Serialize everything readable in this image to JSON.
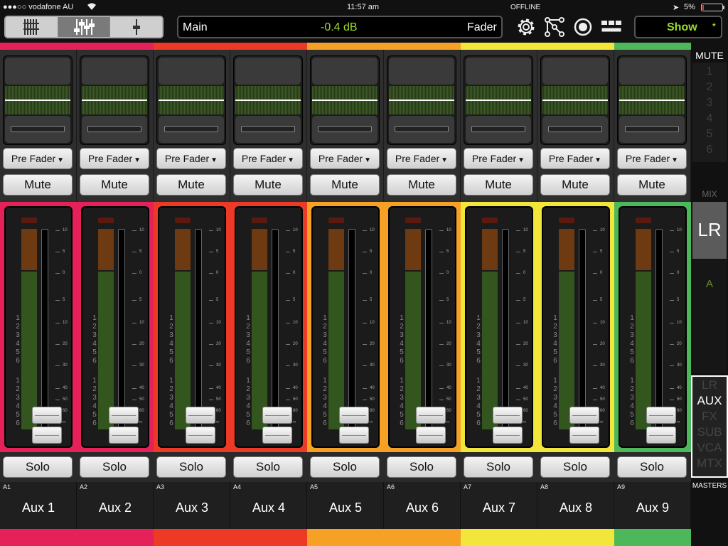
{
  "status": {
    "carrier": "●●●○○ vodafone AU",
    "wifi": "wifi-icon",
    "time": "11:57 am",
    "offline": "OFFLINE",
    "battery": "5%"
  },
  "toolbar": {
    "views": [
      "fader-bank-view",
      "mix-view",
      "single-channel-view"
    ],
    "channel_name": "Main",
    "channel_value": "-0.4 dB",
    "channel_mode": "Fader",
    "show_label": "Show",
    "show_star": "*"
  },
  "strips": [
    {
      "id": "A1",
      "name": "Aux 1",
      "color": "#e6215a",
      "send": "Pre Fader",
      "mute": "Mute",
      "solo": "Solo"
    },
    {
      "id": "A2",
      "name": "Aux 2",
      "color": "#e6215a",
      "send": "Pre Fader",
      "mute": "Mute",
      "solo": "Solo"
    },
    {
      "id": "A3",
      "name": "Aux 3",
      "color": "#ec3a26",
      "send": "Pre Fader",
      "mute": "Mute",
      "solo": "Solo"
    },
    {
      "id": "A4",
      "name": "Aux 4",
      "color": "#ec3a26",
      "send": "Pre Fader",
      "mute": "Mute",
      "solo": "Solo"
    },
    {
      "id": "A5",
      "name": "Aux 5",
      "color": "#f6a025",
      "send": "Pre Fader",
      "mute": "Mute",
      "solo": "Solo"
    },
    {
      "id": "A6",
      "name": "Aux 6",
      "color": "#f6a025",
      "send": "Pre Fader",
      "mute": "Mute",
      "solo": "Solo"
    },
    {
      "id": "A7",
      "name": "Aux 7",
      "color": "#f3e63a",
      "send": "Pre Fader",
      "mute": "Mute",
      "solo": "Solo"
    },
    {
      "id": "A8",
      "name": "Aux 8",
      "color": "#f3e63a",
      "send": "Pre Fader",
      "mute": "Mute",
      "solo": "Solo"
    },
    {
      "id": "A9",
      "name": "Aux 9",
      "color": "#4cb85a",
      "send": "Pre Fader",
      "mute": "Mute",
      "solo": "Solo"
    }
  ],
  "fader_scale": [
    "10",
    "5",
    "0",
    "5",
    "10",
    "20",
    "30",
    "40",
    "50",
    "60",
    "∞"
  ],
  "meter_groups": [
    "1",
    "2",
    "3",
    "4",
    "5",
    "6"
  ],
  "right_panel": {
    "mute_title": "MUTE",
    "mute_groups": [
      "1",
      "2",
      "3",
      "4",
      "5",
      "6"
    ],
    "mix_title": "MIX",
    "mix_selected": "LR",
    "mix_list": [
      "A"
    ],
    "masters_items": [
      "LR",
      "AUX",
      "FX",
      "SUB",
      "VCA",
      "MTX"
    ],
    "masters_active": "AUX",
    "masters_title": "MASTERS"
  }
}
